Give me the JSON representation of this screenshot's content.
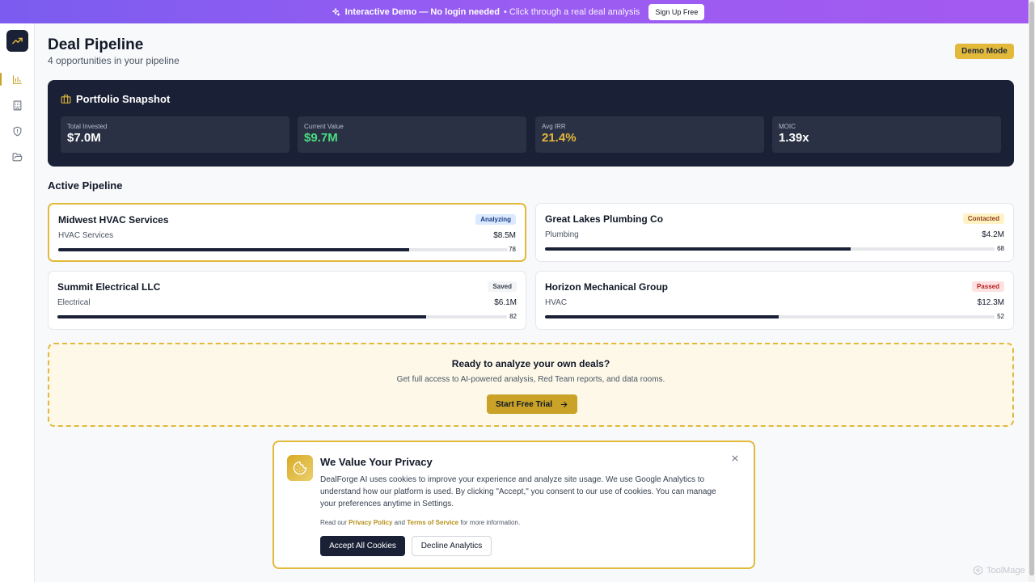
{
  "banner": {
    "highlight": "Interactive Demo — No login needed",
    "sub": "• Click through a real deal analysis",
    "signup_label": "Sign Up Free"
  },
  "sidebar": {
    "items": [
      {
        "name": "pipeline",
        "icon": "bar-chart-icon",
        "active": true
      },
      {
        "name": "companies",
        "icon": "building-icon",
        "active": false
      },
      {
        "name": "security",
        "icon": "shield-icon",
        "active": false
      },
      {
        "name": "data-rooms",
        "icon": "folder-open-icon",
        "active": false
      }
    ]
  },
  "header": {
    "title": "Deal Pipeline",
    "subtitle": "4 opportunities in your pipeline",
    "demo_badge": "Demo Mode"
  },
  "portfolio": {
    "title": "Portfolio Snapshot",
    "stats": [
      {
        "label": "Total Invested",
        "value": "$7.0M",
        "color": "#ffffff"
      },
      {
        "label": "Current Value",
        "value": "$9.7M",
        "color": "#4ade80"
      },
      {
        "label": "Avg IRR",
        "value": "21.4%",
        "color": "#e5b83a"
      },
      {
        "label": "MOIC",
        "value": "1.39x",
        "color": "#ffffff"
      }
    ]
  },
  "pipeline": {
    "title": "Active Pipeline",
    "deals": [
      {
        "name": "Midwest HVAC Services",
        "status": "Analyzing",
        "industry": "HVAC Services",
        "amount": "$8.5M",
        "score": 78,
        "selected": true
      },
      {
        "name": "Great Lakes Plumbing Co",
        "status": "Contacted",
        "industry": "Plumbing",
        "amount": "$4.2M",
        "score": 68,
        "selected": false
      },
      {
        "name": "Summit Electrical LLC",
        "status": "Saved",
        "industry": "Electrical",
        "amount": "$6.1M",
        "score": 82,
        "selected": false
      },
      {
        "name": "Horizon Mechanical Group",
        "status": "Passed",
        "industry": "HVAC",
        "amount": "$12.3M",
        "score": 52,
        "selected": false
      }
    ]
  },
  "cta": {
    "title": "Ready to analyze your own deals?",
    "subtitle": "Get full access to AI-powered analysis, Red Team reports, and data rooms.",
    "button": "Start Free Trial"
  },
  "cookie": {
    "title": "We Value Your Privacy",
    "body": "DealForge AI uses cookies to improve your experience and analyze site usage. We use Google Analytics to understand how our platform is used. By clicking \"Accept,\" you consent to our use of cookies. You can manage your preferences anytime in Settings.",
    "links_prefix": "Read our",
    "privacy_link": "Privacy Policy",
    "links_and": "and",
    "terms_link": "Terms of Service",
    "links_suffix": "for more information.",
    "accept_label": "Accept All Cookies",
    "decline_label": "Decline Analytics"
  },
  "watermark": "ToolMage",
  "colors": {
    "accent_gold": "#e2b93b",
    "navy": "#1a2035",
    "banner_purple": "#8b5cf6"
  }
}
